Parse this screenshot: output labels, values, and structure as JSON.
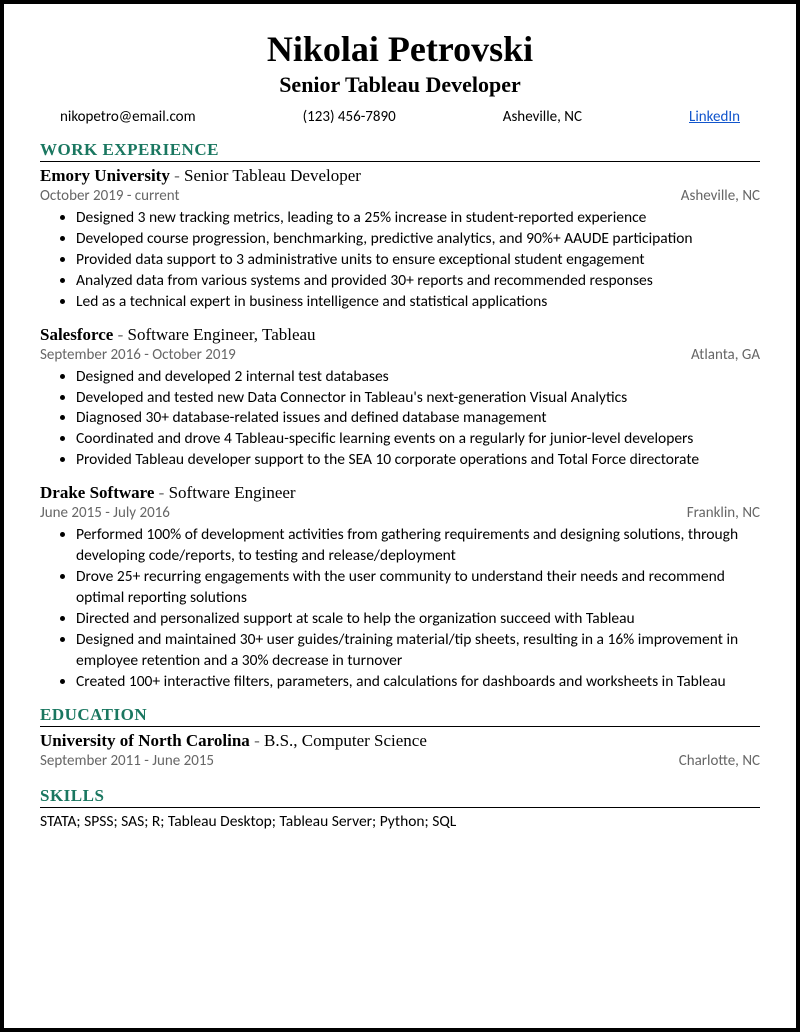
{
  "header": {
    "name": "Nikolai Petrovski",
    "title": "Senior Tableau Developer",
    "email": "nikopetro@email.com",
    "phone": "(123) 456-7890",
    "location": "Asheville, NC",
    "linkedin": "LinkedIn"
  },
  "sections": {
    "work": "WORK EXPERIENCE",
    "education": "EDUCATION",
    "skills": "SKILLS"
  },
  "jobs": [
    {
      "company": "Emory University",
      "role": "Senior Tableau Developer",
      "dates": "October 2019 - current",
      "location": "Asheville, NC",
      "bullets": [
        "Designed 3 new tracking metrics, leading to a 25% increase in student-reported experience",
        "Developed course progression, benchmarking, predictive analytics, and 90%+ AAUDE participation",
        "Provided data support to 3 administrative units to ensure exceptional student engagement",
        "Analyzed data from various systems and provided 30+ reports and recommended responses",
        "Led as a technical expert in business intelligence and statistical applications"
      ]
    },
    {
      "company": "Salesforce",
      "role": "Software Engineer, Tableau",
      "dates": "September 2016 - October 2019",
      "location": "Atlanta, GA",
      "bullets": [
        "Designed and developed 2 internal test databases",
        "Developed and tested new Data Connector in Tableau's next-generation Visual Analytics",
        "Diagnosed 30+ database-related issues and defined database management",
        "Coordinated and drove 4 Tableau-specific learning events on a regularly for junior-level developers",
        "Provided Tableau developer support to the SEA 10 corporate operations and Total Force directorate"
      ]
    },
    {
      "company": "Drake Software",
      "role": "Software Engineer",
      "dates": "June 2015 - July 2016",
      "location": "Franklin, NC",
      "bullets": [
        "Performed 100% of development activities from gathering requirements and designing solutions, through developing code/reports, to testing and release/deployment",
        "Drove 25+ recurring engagements with the user community to understand their needs and recommend optimal reporting solutions",
        "Directed and personalized support at scale to help the organization succeed with Tableau",
        "Designed and maintained 30+ user guides/training material/tip sheets, resulting in a 16% improvement in employee retention and a 30% decrease in turnover",
        "Created 100+ interactive filters, parameters, and calculations for dashboards and worksheets in Tableau"
      ]
    }
  ],
  "education": {
    "school": "University of North Carolina",
    "degree": "B.S.,  Computer Science",
    "dates": "September 2011 - June 2015",
    "location": "Charlotte, NC"
  },
  "skills": "STATA; SPSS; SAS; R; Tableau Desktop; Tableau Server; Python; SQL"
}
